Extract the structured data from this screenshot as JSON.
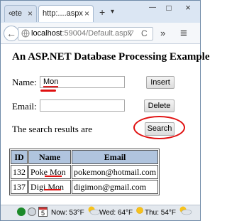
{
  "window": {
    "tabs": [
      {
        "label": "‹ete",
        "close": "×"
      },
      {
        "label": "http:....aspx",
        "close": "×"
      }
    ],
    "new_tab": "+",
    "tab_menu": "▾",
    "controls": {
      "minimize": "—",
      "maximize": "□",
      "close": "×"
    }
  },
  "nav": {
    "back": "←",
    "url_host": "localhost",
    "url_path": ":59004/Default.aspx",
    "dropdown": "▽",
    "reload": "C",
    "overflow": "»",
    "menu": "≡"
  },
  "page": {
    "title": "An ASP.NET Database Processing Example",
    "name_label": "Name:",
    "name_value": "Mon",
    "email_label": "Email:",
    "email_value": "",
    "insert_label": "Insert",
    "delete_label": "Delete",
    "search_label": "Search",
    "results_text": "The search results are",
    "table": {
      "headers": [
        "ID",
        "Name",
        "Email"
      ],
      "rows": [
        [
          "132",
          "Poke Mon",
          "pokemon@hotmail.com"
        ],
        [
          "137",
          "Digi Mon",
          "digimon@gmail.com"
        ]
      ]
    }
  },
  "status_bar": {
    "calendar": "5",
    "weather": [
      {
        "label": "Now: 53°F"
      },
      {
        "label": "Wed: 64°F"
      },
      {
        "label": "Thu: 54°F"
      }
    ]
  },
  "colors": {
    "table_header": "#b0c4de",
    "annotation": "#e01010"
  }
}
